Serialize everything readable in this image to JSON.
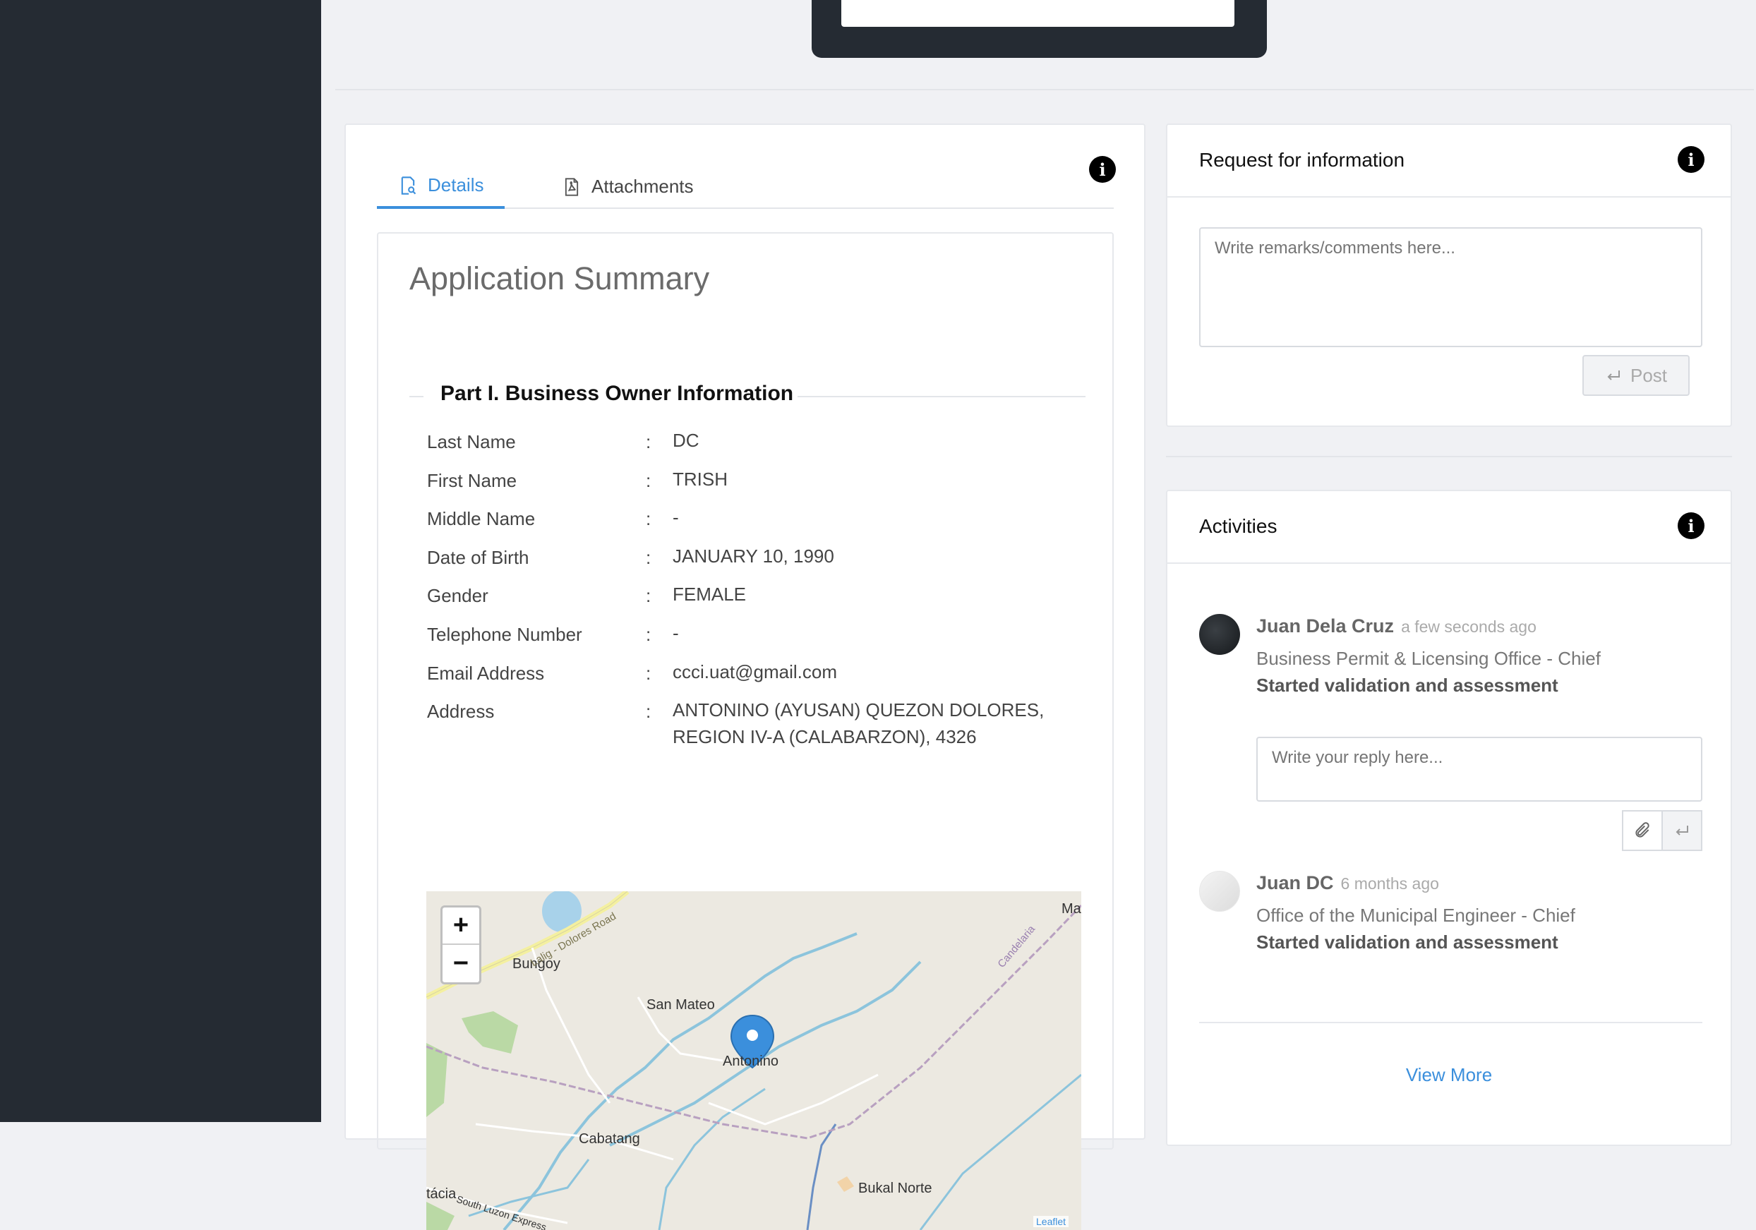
{
  "tabs": {
    "details": "Details",
    "attachments": "Attachments"
  },
  "summary": {
    "title": "Application Summary",
    "section_title": "Part I. Business Owner Information",
    "fields": [
      {
        "label": "Last Name",
        "value": "DC"
      },
      {
        "label": "First Name",
        "value": "TRISH"
      },
      {
        "label": "Middle Name",
        "value": "-"
      },
      {
        "label": "Date of Birth",
        "value": "JANUARY 10, 1990"
      },
      {
        "label": "Gender",
        "value": "FEMALE"
      },
      {
        "label": "Telephone Number",
        "value": "-"
      },
      {
        "label": "Email Address",
        "value": "ccci.uat@gmail.com"
      },
      {
        "label": "Address",
        "value": "ANTONINO (AYUSAN) QUEZON DOLORES, REGION IV-A (CALABARZON), 4326"
      }
    ],
    "colon": ":"
  },
  "map": {
    "zoom_in": "+",
    "zoom_out": "−",
    "labels": [
      "Bungoy",
      "San Mateo",
      "Antonino",
      "Cabatang",
      "Bukal Norte",
      "Lalig - Dolores Road",
      "Candelaria",
      "Ma",
      "tácia",
      "South Luzon Express",
      "Leaflet"
    ]
  },
  "rfi": {
    "title": "Request for information",
    "placeholder": "Write remarks/comments here...",
    "post_label": "Post"
  },
  "activities": {
    "title": "Activities",
    "items": [
      {
        "name": "Juan Dela Cruz",
        "time": "a few seconds ago",
        "role": "Business Permit & Licensing Office - Chief",
        "action": "Started validation and assessment"
      },
      {
        "name": "Juan DC",
        "time": "6 months ago",
        "role": "Office of the Municipal Engineer - Chief",
        "action": "Started validation and assessment"
      }
    ],
    "reply_placeholder": "Write your reply here...",
    "view_more": "View More"
  },
  "info_icon_glyph": "i",
  "colors": {
    "accent": "#3b8fdc",
    "sidebar": "#252b33"
  }
}
